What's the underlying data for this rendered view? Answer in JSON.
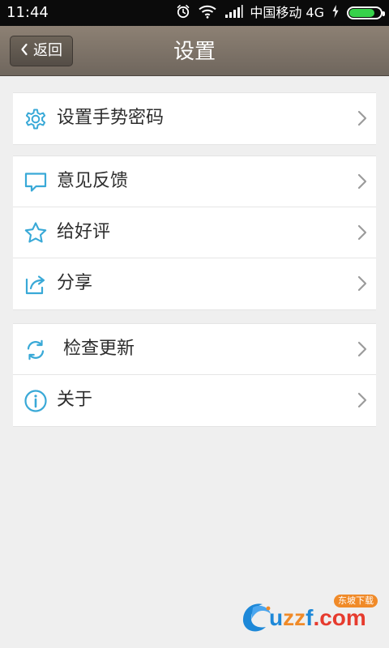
{
  "colors": {
    "status_bar_bg": "#0b0b0b",
    "title_bar_bg": "#7f7468",
    "content_bg": "#efefef",
    "icon_blue": "#39a9d7",
    "chevron_gray": "#9b9b9b",
    "battery_green": "#37d24a"
  },
  "status_bar": {
    "time": "11:44",
    "carrier": "中国移动 4G",
    "icons": [
      "alarm-icon",
      "wifi-icon",
      "signal-icon",
      "charging-icon",
      "battery-icon"
    ],
    "battery_level": 0.86
  },
  "title_bar": {
    "back_label": "返回",
    "title": "设置"
  },
  "settings": {
    "groups": [
      {
        "items": [
          {
            "label": "设置手势密码",
            "icon": "gear-icon"
          }
        ]
      },
      {
        "items": [
          {
            "label": "意见反馈",
            "icon": "chat-bubble-icon"
          },
          {
            "label": "给好评",
            "icon": "star-icon"
          },
          {
            "label": "分享",
            "icon": "share-icon"
          }
        ]
      },
      {
        "items": [
          {
            "label": "检查更新",
            "icon": "refresh-icon"
          },
          {
            "label": "关于",
            "icon": "info-icon"
          }
        ]
      }
    ]
  },
  "watermark": {
    "text": "uzzf.com",
    "badge": "东坡下载",
    "colors": {
      "blue": "#1d88d8",
      "orange": "#f08a28",
      "red": "#e63b2e"
    }
  }
}
